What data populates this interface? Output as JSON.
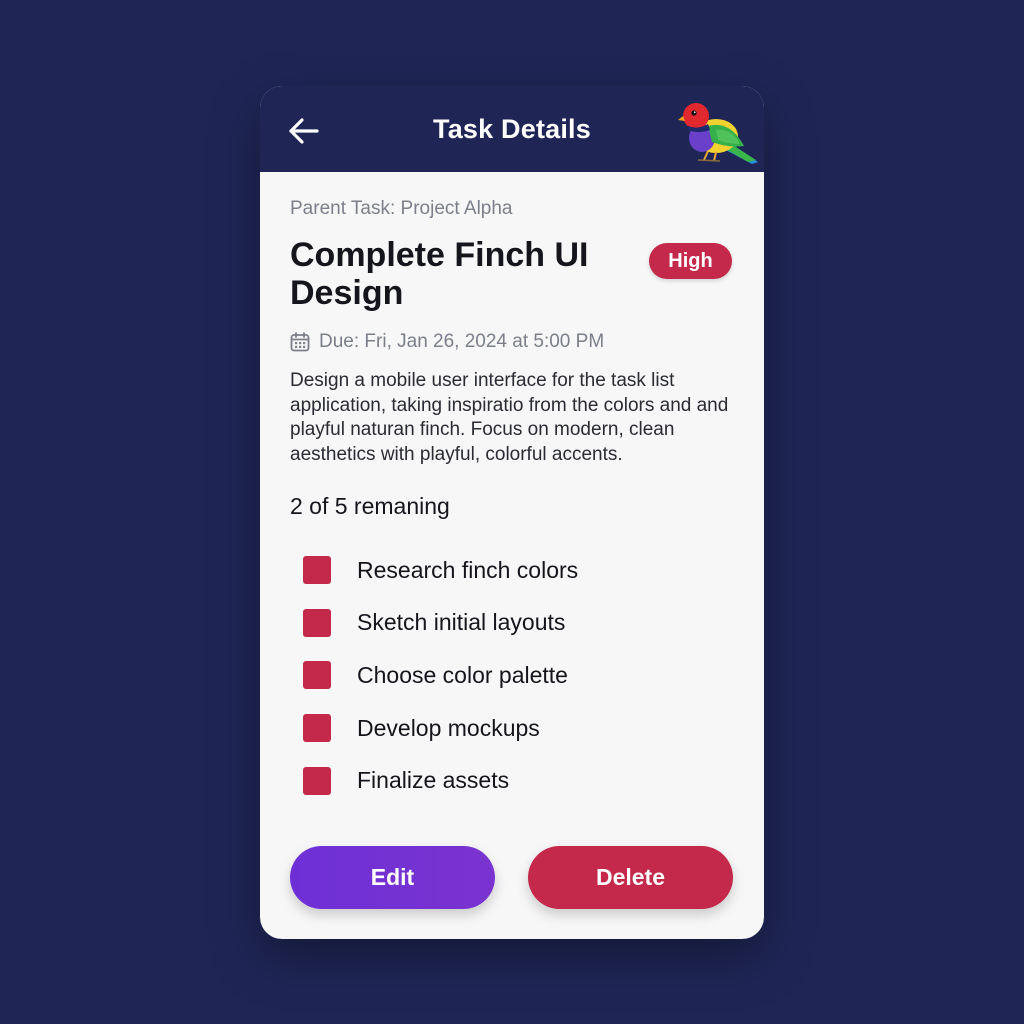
{
  "header": {
    "title": "Task Details",
    "back_icon": "arrow-left-icon",
    "logo_icon": "finch-bird-icon"
  },
  "task": {
    "parent": "Parent Task: Project Alpha",
    "title": "Complete Finch UI Design",
    "priority": "High",
    "due_icon": "calendar-icon",
    "due": "Due: Fri, Jan 26, 2024 at 5:00 PM",
    "description": "Design a mobile user interface for the task list application, taking inspiratio from the colors and and playful naturan finch. Focus on modern, clean aesthetics with playful, colorful accents."
  },
  "subtasks": {
    "summary": "2 of 5 remaning",
    "items": [
      {
        "label": "Research finch colors"
      },
      {
        "label": "Sketch initial layouts"
      },
      {
        "label": "Choose color palette"
      },
      {
        "label": "Develop mockups"
      },
      {
        "label": "Finalize assets"
      }
    ]
  },
  "actions": {
    "edit_label": "Edit",
    "delete_label": "Delete"
  },
  "colors": {
    "background": "#1f2656",
    "accent_red": "#c4284a",
    "accent_purple": "#6e30d6",
    "card": "#f7f7f8"
  }
}
